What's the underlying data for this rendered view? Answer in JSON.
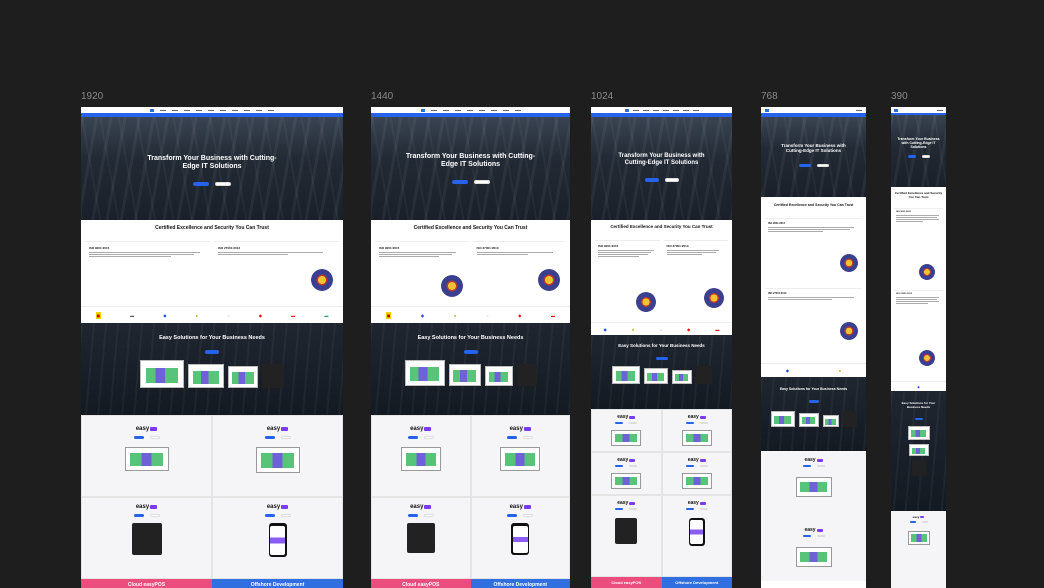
{
  "frames": [
    {
      "label": "1920"
    },
    {
      "label": "1440"
    },
    {
      "label": "1024"
    },
    {
      "label": "768"
    },
    {
      "label": "390"
    }
  ],
  "hero": {
    "title": "Transform Your Business with Cutting-Edge IT Solutions",
    "title_768": "Transform Your Business with Cutting-Edge IT Solutions",
    "title_390": "Transform Your Business with Cutting-Edge IT Solutions"
  },
  "certs": {
    "title": "Certified Excellence and Security You Can Trust",
    "iso9001": "ISO 9001:2015",
    "iso27001": "ISO 27001:2013"
  },
  "easy": {
    "title": "Easy Solutions for Your Business Needs",
    "title_390": "Easy Solutions for Your Business Needs",
    "brand": "easy"
  },
  "bands": {
    "cloud": "Cloud easyPOS",
    "offshore": "Offshore Development"
  },
  "colors": {
    "canvas": "#1e1e1e",
    "accent": "#2563eb",
    "easy_brand": "#7c3aed",
    "cloud_band": "#ec4d7f",
    "offshore_band": "#2f6fe0"
  }
}
